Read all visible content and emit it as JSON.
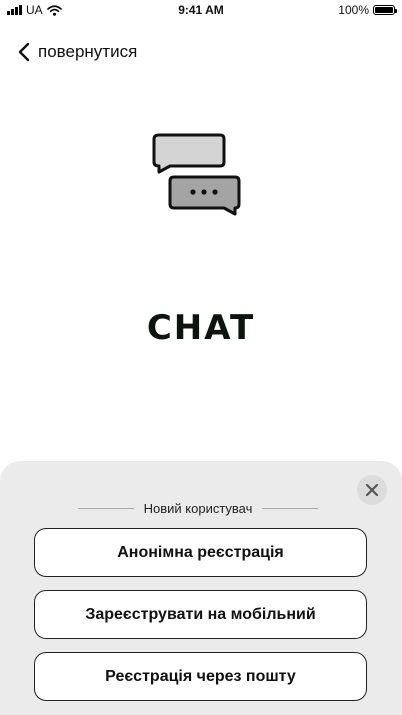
{
  "status_bar": {
    "carrier": "UA",
    "time": "9:41 AM",
    "battery": "100%",
    "battery_level": 1.0
  },
  "nav": {
    "back_label": "повернутися"
  },
  "hero": {
    "title": "CHAT",
    "icon": "chat-bubbles-icon"
  },
  "sheet": {
    "section_label": "Новий користувач",
    "close_icon": "close-icon",
    "buttons": [
      {
        "label": "Анонімна реєстрація"
      },
      {
        "label": "Зареєструвати на мобільний"
      },
      {
        "label": "Реєстрація через пошту"
      }
    ]
  },
  "colors": {
    "background": "#ffffff",
    "sheet_background": "#ebebeb",
    "title": "#0d1410",
    "bubble_top": "#d4d4d4",
    "bubble_bottom": "#a4a4a4"
  }
}
